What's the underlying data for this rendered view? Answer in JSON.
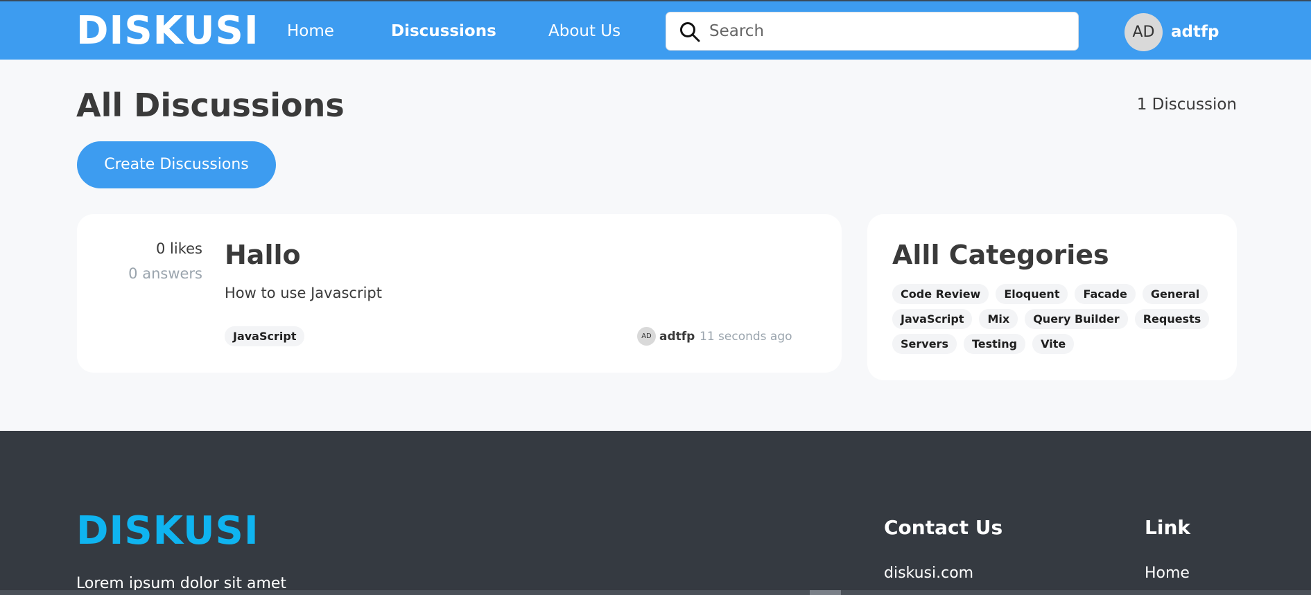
{
  "navbar": {
    "brand": "DISKUSI",
    "links": [
      "Home",
      "Discussions",
      "About Us"
    ],
    "search_placeholder": "Search",
    "search_icon": "search-icon",
    "user_initials": "AD",
    "username": "adtfp",
    "color": "#3d9cf0"
  },
  "header": {
    "title": "All Discussions",
    "count": "1 Discussion",
    "create_button": "Create Discussions"
  },
  "discussions": [
    {
      "likes": "0 likes",
      "answers": "0 answers",
      "title": "Hallo",
      "body": "How to use Javascript",
      "tag": "JavaScript",
      "author_initials": "AD",
      "author": "adtfp",
      "time": "11 seconds ago"
    }
  ],
  "categories": {
    "title": "Alll Categories",
    "items": [
      "Code Review",
      "Eloquent",
      "Facade",
      "General",
      "JavaScript",
      "Mix",
      "Query Builder",
      "Requests",
      "Servers",
      "Testing",
      "Vite"
    ]
  },
  "footer": {
    "brand": "DISKUSI",
    "tagline": "Lorem ipsum dolor sit amet",
    "contact_heading": "Contact Us",
    "contact_item": "diskusi.com",
    "link_heading": "Link",
    "link_item": "Home",
    "brand_color": "#0fb4f0",
    "background": "#353a41"
  }
}
